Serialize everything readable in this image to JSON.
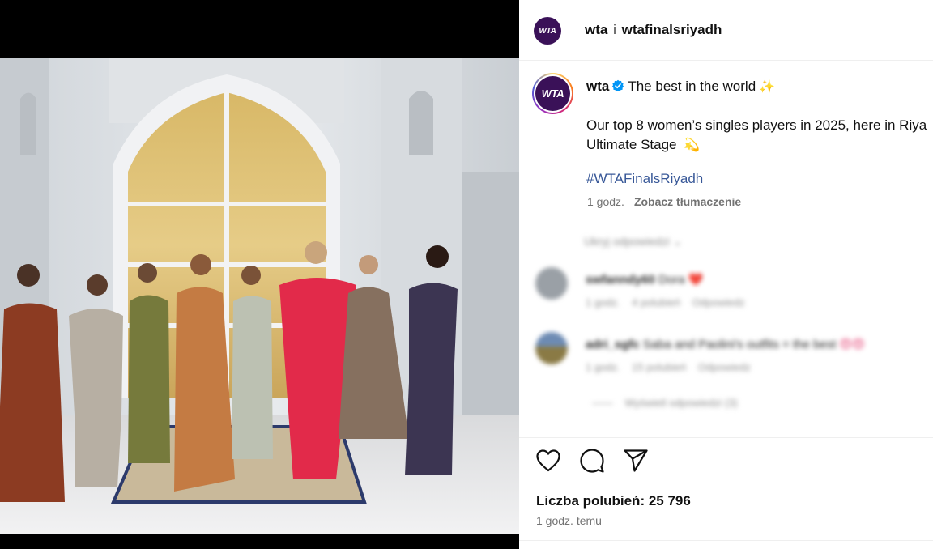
{
  "post": {
    "header": {
      "avatar_text": "WTA",
      "username": "wta",
      "separator": "i",
      "collaborator": "wtafinalsriyadh"
    },
    "caption": {
      "avatar_text": "WTA",
      "username": "wta",
      "verified_icon": "verified-badge-icon",
      "headline": "The best in the world",
      "headline_emoji": "✨",
      "body_line1": "Our top 8 women’s singles players in 2025, here in Riya",
      "body_line2": "Ultimate Stage",
      "body_emoji": "💫",
      "hashtag": "#WTAFinalsRiyadh",
      "time": "1 godz.",
      "translate": "Zobacz tłumaczenie"
    },
    "comments": {
      "hide_label": "Ukryj odpowiedzi",
      "items": [
        {
          "username": "swfanndy60",
          "text": "Dora",
          "emoji": "❤️",
          "time": "1 godz.",
          "likes": "4 polubień",
          "reply": "Odpowiedz"
        },
        {
          "username": "adri_sgfc",
          "text": "Saba and Paolini's outfits = the best",
          "emoji": "😍😍",
          "time": "1 godz.",
          "likes": "15 polubień",
          "reply": "Odpowiedz"
        }
      ],
      "view_replies": "Wyświetl odpowiedzi (3)"
    },
    "actions": {
      "like_icon": "heart-icon",
      "comment_icon": "comment-icon",
      "share_icon": "share-icon"
    },
    "likes_label": "Liczba polubień:",
    "likes_count": "25 796",
    "posted_ago": "1 godz. temu"
  },
  "colors": {
    "accent_link": "#385898",
    "wta_purple": "#3a1158",
    "verified_blue": "#0095f6"
  }
}
